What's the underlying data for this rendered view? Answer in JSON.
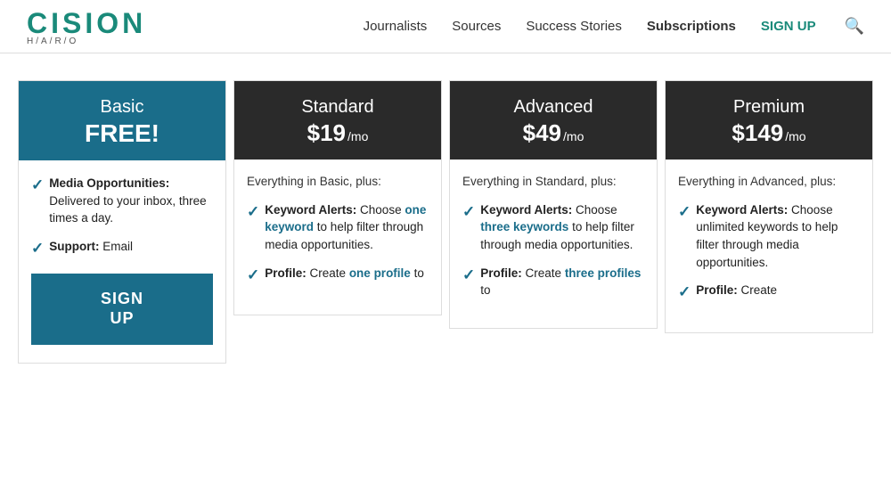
{
  "nav": {
    "logo": "CISION",
    "logo_sub": "H/A/R/O",
    "links": [
      {
        "label": "Journalists",
        "bold": false,
        "teal": false
      },
      {
        "label": "Sources",
        "bold": false,
        "teal": false
      },
      {
        "label": "Success Stories",
        "bold": false,
        "teal": false
      },
      {
        "label": "Subscriptions",
        "bold": true,
        "teal": false
      },
      {
        "label": "SIGN UP",
        "bold": true,
        "teal": true
      }
    ]
  },
  "plans": [
    {
      "id": "basic",
      "name": "Basic",
      "price_label": "FREE!",
      "is_free": true,
      "header_class": "teal",
      "intro": null,
      "features": [
        {
          "bold": "Media Opportunities:",
          "text": " Delivered to your inbox, three times a day."
        },
        {
          "bold": "Support:",
          "text": " Email"
        }
      ],
      "cta": "SIGN\nUP"
    },
    {
      "id": "standard",
      "name": "Standard",
      "price": "$19",
      "per": "/mo",
      "is_free": false,
      "header_class": "dark",
      "intro": "Everything in Basic, plus:",
      "features": [
        {
          "bold": "Keyword Alerts:",
          "text": " Choose ",
          "highlight": "one keyword",
          "text2": " to help filter through media opportunities."
        },
        {
          "bold": "Profile:",
          "text": " Create ",
          "highlight": "one profile",
          "text2": " to"
        }
      ],
      "cta": null
    },
    {
      "id": "advanced",
      "name": "Advanced",
      "price": "$49",
      "per": "/mo",
      "is_free": false,
      "header_class": "dark",
      "intro": "Everything in Standard, plus:",
      "features": [
        {
          "bold": "Keyword Alerts:",
          "text": " Choose ",
          "highlight": "three keywords",
          "text2": " to help filter through media opportunities."
        },
        {
          "bold": "Profile:",
          "text": " Create ",
          "highlight": "three profiles",
          "text2": " to"
        }
      ],
      "cta": null
    },
    {
      "id": "premium",
      "name": "Premium",
      "price": "$149",
      "per": "/mo",
      "is_free": false,
      "header_class": "dark",
      "intro": "Everything in Advanced, plus:",
      "features": [
        {
          "bold": "Keyword Alerts:",
          "text": " Choose unlimited keywords to help filter through media opportunities."
        },
        {
          "bold": "Profile:",
          "text": " Create"
        }
      ],
      "cta": null
    }
  ],
  "colors": {
    "teal_header": "#1a6d8a",
    "dark_header": "#2a2a2a",
    "highlight": "#1a6d8a"
  }
}
